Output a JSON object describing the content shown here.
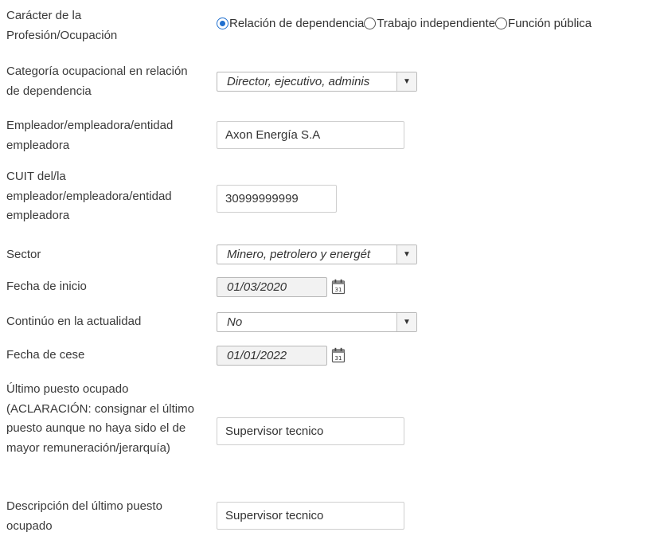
{
  "fields": {
    "caracter": {
      "label": "Carácter de la Profesión/Ocupación",
      "options": [
        "Relación de dependencia",
        "Trabajo independiente",
        "Función pública"
      ],
      "selected": "Relación de dependencia"
    },
    "categoria": {
      "label": "Categoría ocupacional en relación de dependencia",
      "value": "Director, ejecutivo, adminis"
    },
    "empleador": {
      "label": "Empleador/empleadora/entidad empleadora",
      "value": "Axon Energía S.A"
    },
    "cuit": {
      "label": "CUIT del/la empleador/empleadora/entidad empleadora",
      "value": "30999999999"
    },
    "sector": {
      "label": "Sector",
      "value": "Minero, petrolero y energét"
    },
    "fecha_inicio": {
      "label": "Fecha de inicio",
      "value": "01/03/2020"
    },
    "continuo": {
      "label": "Continúo en la actualidad",
      "value": "No"
    },
    "fecha_cese": {
      "label": "Fecha de cese",
      "value": "01/01/2022"
    },
    "ultimo_puesto": {
      "label": "Último puesto ocupado (ACLARACIÓN: consignar el último puesto aunque no haya sido el de mayor remuneración/jerarquía)",
      "value": "Supervisor tecnico"
    },
    "descripcion": {
      "label": "Descripción del último puesto ocupado",
      "value": "Supervisor tecnico"
    }
  },
  "icons": {
    "calendar": "calendar-icon",
    "dropdown": "chevron-down-icon"
  }
}
